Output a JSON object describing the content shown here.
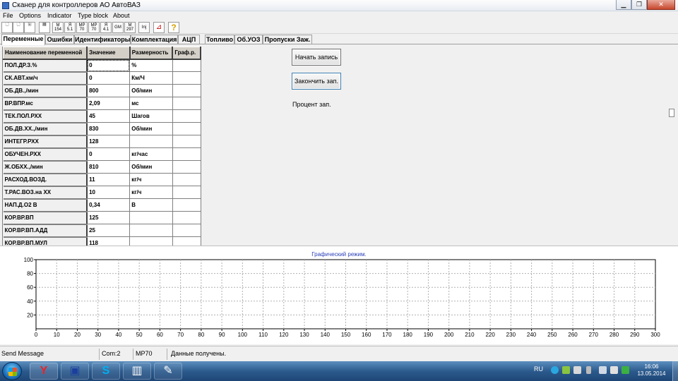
{
  "window": {
    "title": "Сканер для  контроллеров АО АвтоВАЗ",
    "buttons": {
      "minimize": "▁",
      "maximize": "❐",
      "close": "✕"
    }
  },
  "menu": [
    "File",
    "Options",
    "Indicator",
    "Type block",
    "About"
  ],
  "toolbar": {
    "models": [
      {
        "top": "M",
        "bottom": "154"
      },
      {
        "top": "Я",
        "bottom": "5.1"
      },
      {
        "top": "MP",
        "bottom": "70"
      },
      {
        "top": "MP",
        "bottom": "70"
      },
      {
        "top": "Я",
        "bottom": "4.1"
      },
      {
        "top": "GM",
        "bottom": ""
      },
      {
        "top": "M",
        "bottom": "297"
      },
      {
        "top": "Inj",
        "bottom": ""
      }
    ]
  },
  "tabs": [
    "Переменные",
    "Ошибки",
    "Идентификаторы",
    "Комплектация",
    "АЦП",
    "Топливо",
    "Об.УОЗ",
    "Пропуски Заж."
  ],
  "grid": {
    "headers": [
      "Наименование переменной",
      "Значение",
      "Размерность",
      "Граф.р."
    ],
    "rows": [
      {
        "name": "ПОЛ.ДР.З.%",
        "value": "0",
        "unit": "%"
      },
      {
        "name": "СК.АВТ.км/ч",
        "value": "0",
        "unit": "Км/Ч"
      },
      {
        "name": "ОБ.ДВ.,/мин",
        "value": "800",
        "unit": "Об/мин"
      },
      {
        "name": "ВР.ВПР.мс",
        "value": "2,09",
        "unit": "мс"
      },
      {
        "name": "ТЕК.ПОЛ.РХХ",
        "value": "45",
        "unit": "Шагов"
      },
      {
        "name": "ОБ.ДВ.ХХ.,/мин",
        "value": "830",
        "unit": "Об/мин"
      },
      {
        "name": "ИНТЕГР.РХХ",
        "value": "128",
        "unit": ""
      },
      {
        "name": "ОБУЧЕН.РХХ",
        "value": "0",
        "unit": "кг/час"
      },
      {
        "name": "Ж.ОБХХ.,/мин",
        "value": "810",
        "unit": "Об/мин"
      },
      {
        "name": "РАСХОД.ВОЗД.",
        "value": "11",
        "unit": "кг/ч"
      },
      {
        "name": "Т.РАС.ВОЗ.на ХХ",
        "value": "10",
        "unit": "кг/ч"
      },
      {
        "name": "НАП.Д.О2 В",
        "value": "0,34",
        "unit": "В"
      },
      {
        "name": "КОР.ВР.ВП",
        "value": "125",
        "unit": ""
      },
      {
        "name": "КОР.ВР.ВП.АДД",
        "value": "25",
        "unit": ""
      },
      {
        "name": "КОР.ВР.ВП.МУЛ",
        "value": "118",
        "unit": ""
      }
    ]
  },
  "controls": {
    "start_record": "Начать запись",
    "stop_record": "Закончить зап.",
    "percent_label": "Процент зап."
  },
  "chart_data": {
    "type": "line",
    "title": "Графический режим.",
    "xlim": [
      0,
      300
    ],
    "ylim": [
      0,
      100
    ],
    "x_ticks": [
      0,
      10,
      20,
      30,
      40,
      50,
      60,
      70,
      80,
      90,
      100,
      110,
      120,
      130,
      140,
      150,
      160,
      170,
      180,
      190,
      200,
      210,
      220,
      230,
      240,
      250,
      260,
      270,
      280,
      290,
      300
    ],
    "y_ticks": [
      20,
      40,
      60,
      80,
      100
    ],
    "grid": true,
    "series": []
  },
  "status": {
    "message": "Send Message",
    "port": "Com:2",
    "block": "MP70",
    "state": "Данные получены."
  },
  "taskbar": {
    "lang": "RU",
    "time": "16:06",
    "date": "13.05.2014",
    "colors": {
      "accent": "#2c5a8d"
    }
  }
}
